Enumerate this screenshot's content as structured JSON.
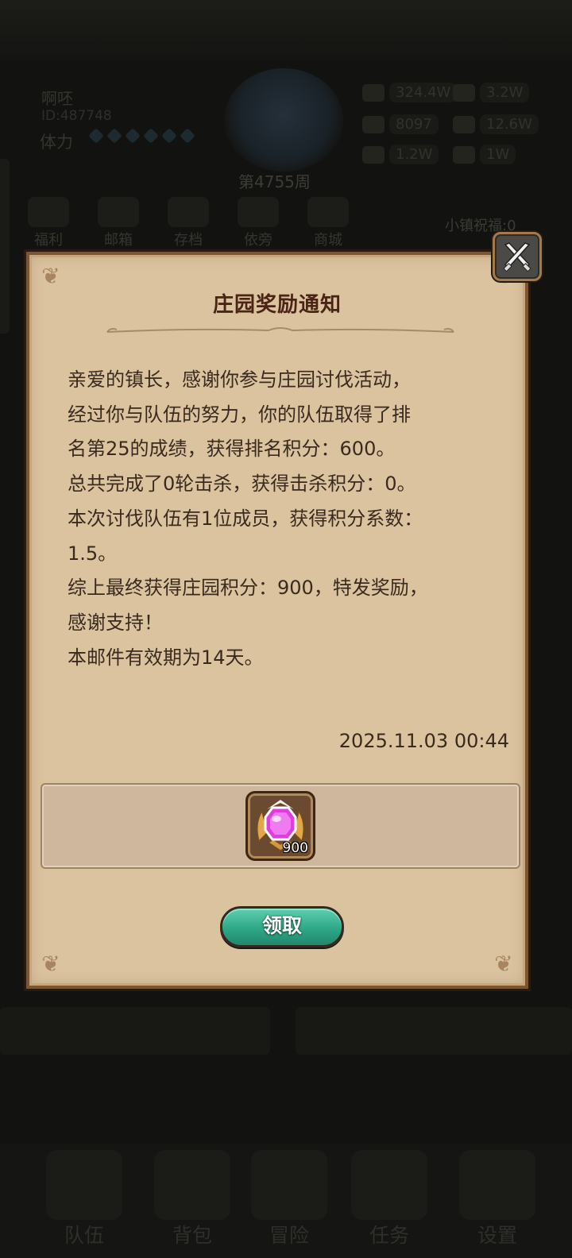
{
  "background": {
    "player_name": "啊呸",
    "player_id": "ID:487748",
    "stamina_label": "体力",
    "week_label": "第4755周",
    "resources": [
      "324.4W",
      "3.2W",
      "8097",
      "12.6W",
      "1.2W",
      "1W"
    ],
    "nav_items": [
      "福利",
      "邮箱",
      "存档",
      "依旁",
      "商城"
    ],
    "town_label": "小镇祝福:0",
    "bottom_nav": [
      "队伍",
      "背包",
      "冒险",
      "任务",
      "设置"
    ]
  },
  "dialog": {
    "title": "庄园奖励通知",
    "body_lines": [
      "亲爱的镇长，感谢你参与庄园讨伐活动，",
      "经过你与队伍的努力，你的队伍取得了排",
      "名第25的成绩，获得排名积分：600。",
      "总共完成了0轮击杀，获得击杀积分：0。",
      "本次讨伐队伍有1位成员，获得积分系数：",
      "1.5。",
      "综上最终获得庄园积分：900，特发奖励，",
      "感谢支持！",
      "本邮件有效期为14天。"
    ],
    "date": "2025.11.03 00:44",
    "reward": {
      "icon": "manor-points-gem-icon",
      "count": "900"
    },
    "claim_label": "领取",
    "close_icon": "crossed-swords-close-icon"
  },
  "colors": {
    "parchment": "#dbc3a0",
    "title": "#4a2414",
    "button_teal": "#2ea888",
    "gem_pink": "#e23ce0"
  }
}
